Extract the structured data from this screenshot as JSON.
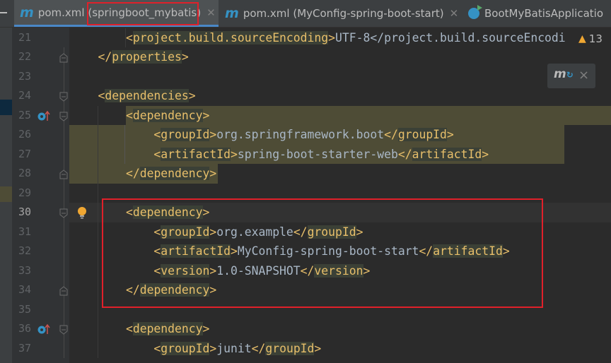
{
  "tabs": [
    {
      "label": "pom.xml",
      "module": "(springboot_mybatis)",
      "icon": "maven-icon",
      "active": true
    },
    {
      "label": "pom.xml",
      "module": "(MyConfig-spring-boot-start)",
      "icon": "maven-icon",
      "active": false
    },
    {
      "label": "BootMyBatisApplicatio",
      "icon": "spring-run-icon",
      "active": false
    }
  ],
  "warnings": {
    "count": "13",
    "icon": "warning-icon"
  },
  "maven_popup": {
    "icon": "maven-reload-icon",
    "close": "×"
  },
  "colors": {
    "tag": "#e8bf6a",
    "text": "#a9b7c6",
    "highlight": "#4e4c36",
    "annotation": "#e0202a"
  },
  "lines": [
    {
      "n": "21",
      "text": "        <project.build.sourceEncoding>UTF-8</project.build.sourceEncodi"
    },
    {
      "n": "22",
      "text": "    </properties>"
    },
    {
      "n": "23",
      "text": ""
    },
    {
      "n": "24",
      "text": "    <dependencies>"
    },
    {
      "n": "25",
      "text": "        <dependency>"
    },
    {
      "n": "26",
      "text": "            <groupId>org.springframework.boot</groupId>"
    },
    {
      "n": "27",
      "text": "            <artifactId>spring-boot-starter-web</artifactId>"
    },
    {
      "n": "28",
      "text": "        </dependency>"
    },
    {
      "n": "29",
      "text": ""
    },
    {
      "n": "30",
      "text": "        <dependency>"
    },
    {
      "n": "31",
      "text": "            <groupId>org.example</groupId>"
    },
    {
      "n": "32",
      "text": "            <artifactId>MyConfig-spring-boot-start</artifactId>"
    },
    {
      "n": "33",
      "text": "            <version>1.0-SNAPSHOT</version>"
    },
    {
      "n": "34",
      "text": "        </dependency>"
    },
    {
      "n": "35",
      "text": ""
    },
    {
      "n": "36",
      "text": "        <dependency>"
    },
    {
      "n": "37",
      "text": "            <groupId>junit</groupId>"
    }
  ]
}
